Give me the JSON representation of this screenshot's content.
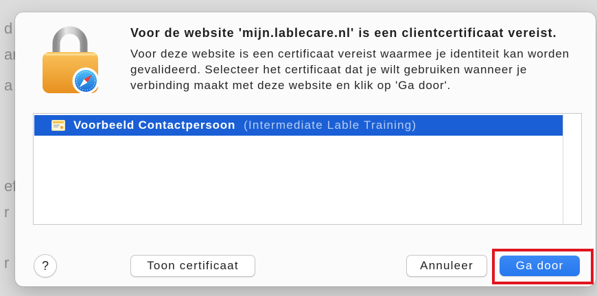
{
  "background": {
    "fragments": [
      "d",
      "ar",
      "a",
      "ef",
      "r",
      "r"
    ]
  },
  "dialog": {
    "icon": "lock-with-safari-badge-icon",
    "title": "Voor de website 'mijn.lablecare.nl' is een clientcertificaat vereist.",
    "message_lines": [
      "Voor deze website is een certificaat vereist waarmee je identiteit kan worden",
      "gevalideerd. Selecteer het certificaat dat je wilt gebruiken wanneer je",
      "verbinding maakt met deze website en klik op 'Ga door'."
    ],
    "certificates": [
      {
        "icon": "certificate-icon",
        "name": "Voorbeeld Contactpersoon",
        "issuer": "(Intermediate Lable Training)",
        "selected": true
      }
    ],
    "buttons": {
      "help": "?",
      "show_certificate": "Toon certificaat",
      "cancel": "Annuleer",
      "continue": "Ga door"
    }
  },
  "annotation": {
    "highlighted": "continue-button"
  },
  "colors": {
    "selection": "#1a5fd5",
    "primary_button": "#2777ee",
    "highlight": "#e0151f",
    "issuer_text": "#b7cdf4",
    "lock_body": "#f0a83a",
    "badge": "#1a6bd6"
  }
}
